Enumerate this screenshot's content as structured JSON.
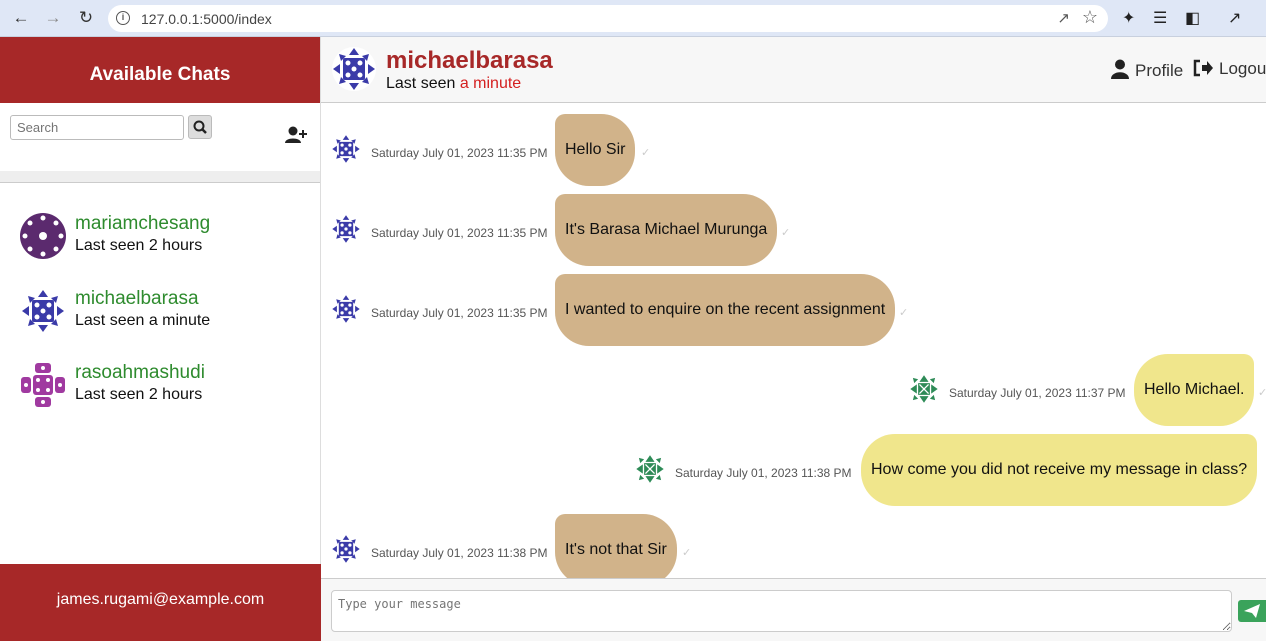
{
  "browser": {
    "url": "127.0.0.1:5000/index",
    "back_icon": "arrow-left",
    "forward_icon": "arrow-right",
    "reload_icon": "reload"
  },
  "sidebar": {
    "title": "Available Chats",
    "search_placeholder": "Search",
    "contacts": [
      {
        "name": "mariamchesang",
        "seen": "Last seen 2 hours"
      },
      {
        "name": "michaelbarasa",
        "seen": "Last seen a minute"
      },
      {
        "name": "rasoahmashudi",
        "seen": "Last seen 2 hours"
      }
    ],
    "footer_email": "james.rugami@example.com"
  },
  "header": {
    "name": "michaelbarasa",
    "seen_prefix": "Last seen ",
    "seen_highlight": "a minute",
    "profile_label": "Profile",
    "logout_label": "Logou"
  },
  "messages": [
    {
      "direction": "in",
      "timestamp": "Saturday July 01, 2023 11:35 PM",
      "text": "Hello Sir"
    },
    {
      "direction": "in",
      "timestamp": "Saturday July 01, 2023 11:35 PM",
      "text": "It's Barasa Michael Murunga"
    },
    {
      "direction": "in",
      "timestamp": "Saturday July 01, 2023 11:35 PM",
      "text": "I wanted to enquire on the recent assignment"
    },
    {
      "direction": "out",
      "timestamp": "Saturday July 01, 2023 11:37 PM",
      "text": "Hello Michael."
    },
    {
      "direction": "out",
      "timestamp": "Saturday July 01, 2023 11:38 PM",
      "text": "How come you did not receive my message in class?"
    },
    {
      "direction": "in",
      "timestamp": "Saturday July 01, 2023 11:38 PM",
      "text": "It's not that Sir"
    }
  ],
  "composer": {
    "placeholder": "Type your message"
  },
  "colors": {
    "brand_red": "#a72828",
    "incoming_bubble": "#d1b38a",
    "outgoing_bubble": "#f0e68c",
    "contact_name_green": "#2e8b2e",
    "send_green": "#3aa35b"
  }
}
